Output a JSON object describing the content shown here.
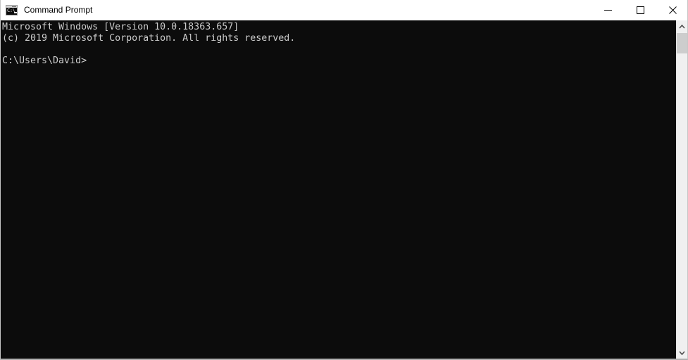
{
  "window": {
    "title": "Command Prompt",
    "app_icon": "cmd-console-icon",
    "icon_text": "C:\\",
    "background_color": "#0c0c0c",
    "titlebar_color": "#ffffff",
    "text_color": "#cccccc"
  },
  "caption": {
    "minimize_label": "Minimize",
    "maximize_label": "Maximize",
    "close_label": "Close"
  },
  "console": {
    "lines": [
      "Microsoft Windows [Version 10.0.18363.657]",
      "(c) 2019 Microsoft Corporation. All rights reserved.",
      "",
      "C:\\Users\\David>"
    ],
    "content": "Microsoft Windows [Version 10.0.18363.657]\n(c) 2019 Microsoft Corporation. All rights reserved.\n\nC:\\Users\\David>",
    "prompt": "C:\\Users\\David>",
    "banner_line_1": "Microsoft Windows [Version 10.0.18363.657]",
    "banner_line_2": "(c) 2019 Microsoft Corporation. All rights reserved."
  },
  "scrollbar": {
    "up_arrow": "chevron-up-icon",
    "down_arrow": "chevron-down-icon",
    "thumb_color": "#cdcdcd",
    "track_color": "#f0f0f0"
  }
}
